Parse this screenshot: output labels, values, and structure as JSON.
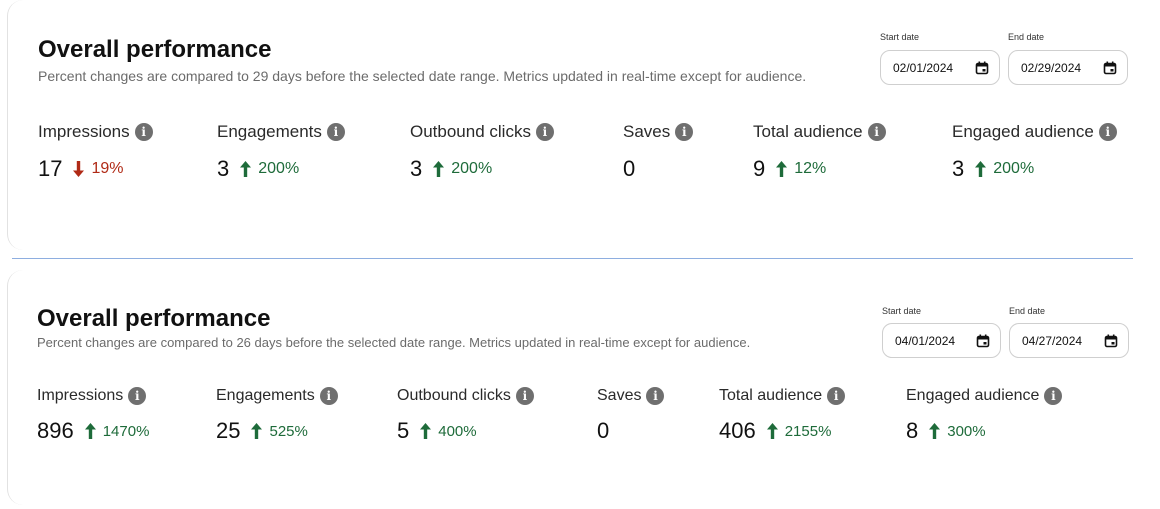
{
  "colors": {
    "up": "#1e6b3a",
    "down": "#b02a16",
    "info_icon": "#6f6f6f",
    "separator": "#8eaee0"
  },
  "panels": [
    {
      "title": "Overall performance",
      "subtitle": "Percent changes are compared to 29 days before the selected date range. Metrics updated in real-time except for audience.",
      "start_label": "Start date",
      "start_value": "02/01/2024",
      "end_label": "End date",
      "end_value": "02/29/2024",
      "metrics": [
        {
          "label": "Impressions",
          "value": "17",
          "change": "19%",
          "direction": "down"
        },
        {
          "label": "Engagements",
          "value": "3",
          "change": "200%",
          "direction": "up"
        },
        {
          "label": "Outbound clicks",
          "value": "3",
          "change": "200%",
          "direction": "up"
        },
        {
          "label": "Saves",
          "value": "0",
          "change": "",
          "direction": "none"
        },
        {
          "label": "Total audience",
          "value": "9",
          "change": "12%",
          "direction": "up"
        },
        {
          "label": "Engaged audience",
          "value": "3",
          "change": "200%",
          "direction": "up"
        }
      ]
    },
    {
      "title": "Overall performance",
      "subtitle": "Percent changes are compared to 26 days before the selected date range. Metrics updated in real-time except for audience.",
      "start_label": "Start date",
      "start_value": "04/01/2024",
      "end_label": "End date",
      "end_value": "04/27/2024",
      "metrics": [
        {
          "label": "Impressions",
          "value": "896",
          "change": "1470%",
          "direction": "up"
        },
        {
          "label": "Engagements",
          "value": "25",
          "change": "525%",
          "direction": "up"
        },
        {
          "label": "Outbound clicks",
          "value": "5",
          "change": "400%",
          "direction": "up"
        },
        {
          "label": "Saves",
          "value": "0",
          "change": "",
          "direction": "none"
        },
        {
          "label": "Total audience",
          "value": "406",
          "change": "2155%",
          "direction": "up"
        },
        {
          "label": "Engaged audience",
          "value": "8",
          "change": "300%",
          "direction": "up"
        }
      ]
    }
  ]
}
